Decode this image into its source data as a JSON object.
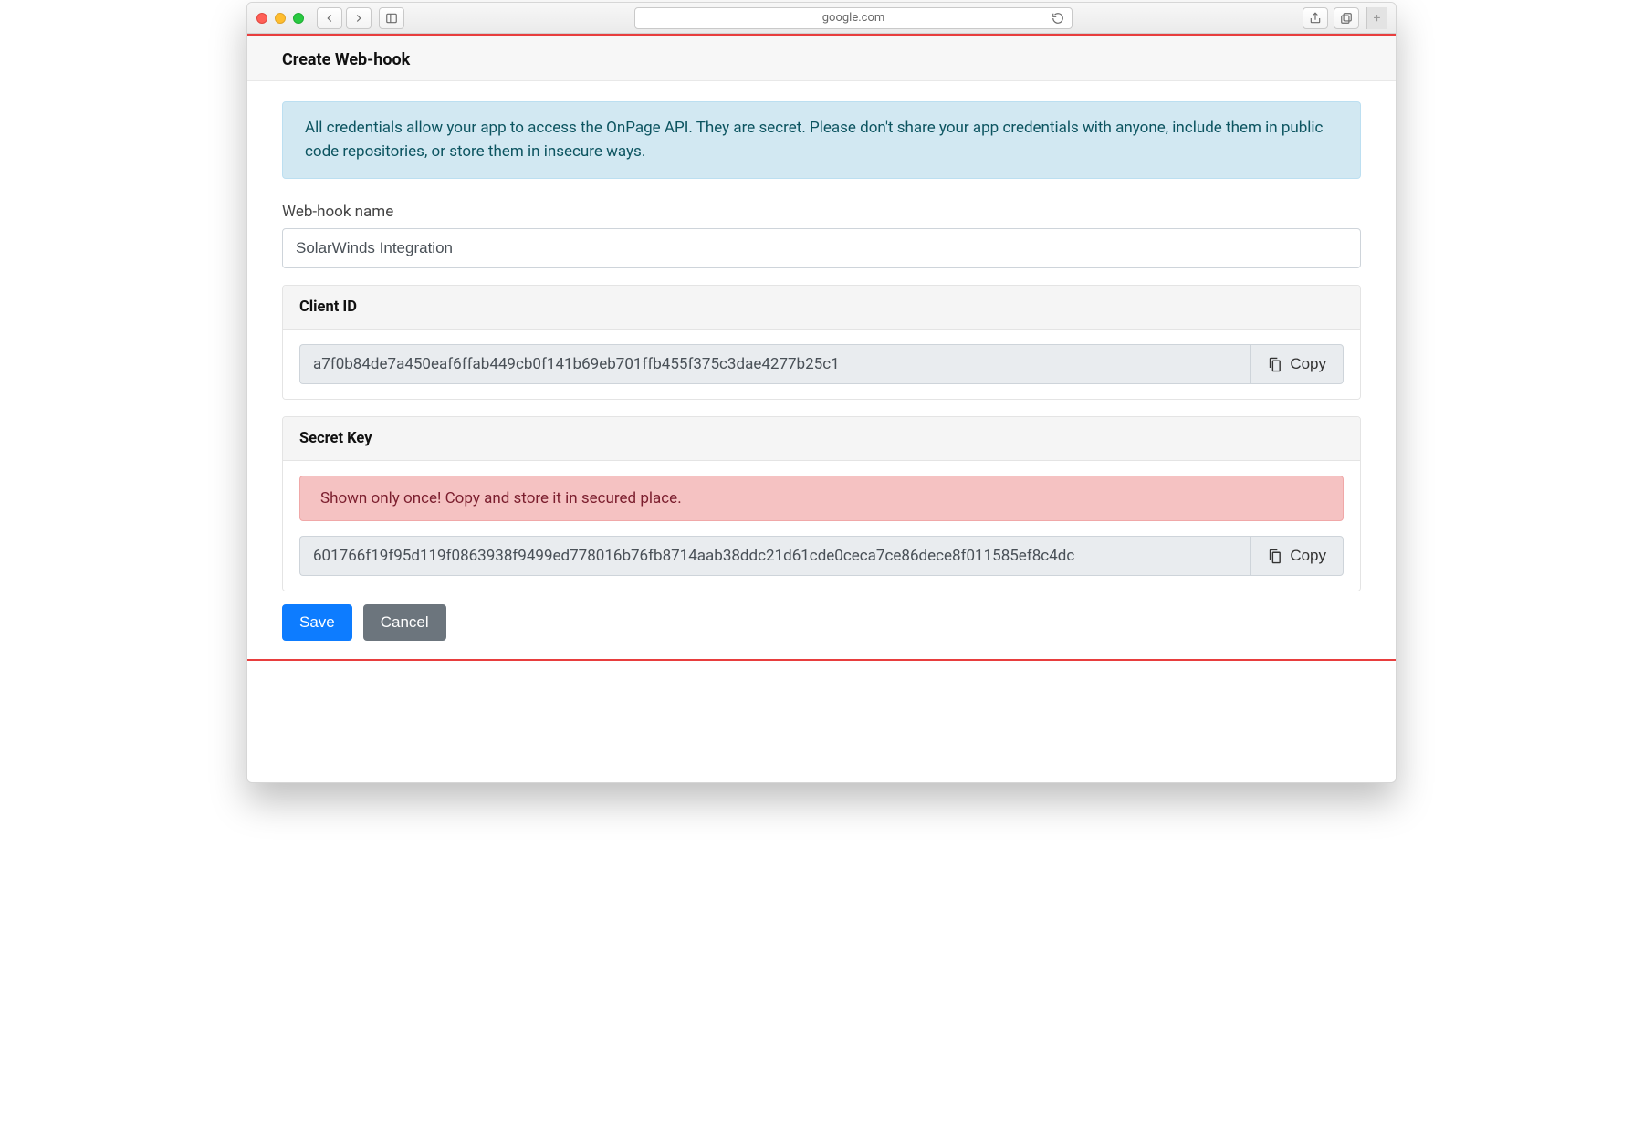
{
  "browser": {
    "url": "google.com"
  },
  "page": {
    "title": "Create Web-hook",
    "info_message": "All credentials allow your app to access the OnPage API. They are secret. Please don't share your app credentials with anyone, include them in public code repositories, or store them in insecure ways.",
    "name_label": "Web-hook name",
    "name_value": "SolarWinds Integration",
    "client_id": {
      "label": "Client ID",
      "value": "a7f0b84de7a450eaf6ffab449cb0f141b69eb701ffb455f375c3dae4277b25c1",
      "copy_label": "Copy"
    },
    "secret_key": {
      "label": "Secret Key",
      "warning": "Shown only once! Copy and store it in secured place.",
      "value": "601766f19f95d119f0863938f9499ed778016b76fb8714aab38ddc21d61cde0ceca7ce86dece8f011585ef8c4dc",
      "copy_label": "Copy"
    },
    "actions": {
      "save": "Save",
      "cancel": "Cancel"
    }
  }
}
